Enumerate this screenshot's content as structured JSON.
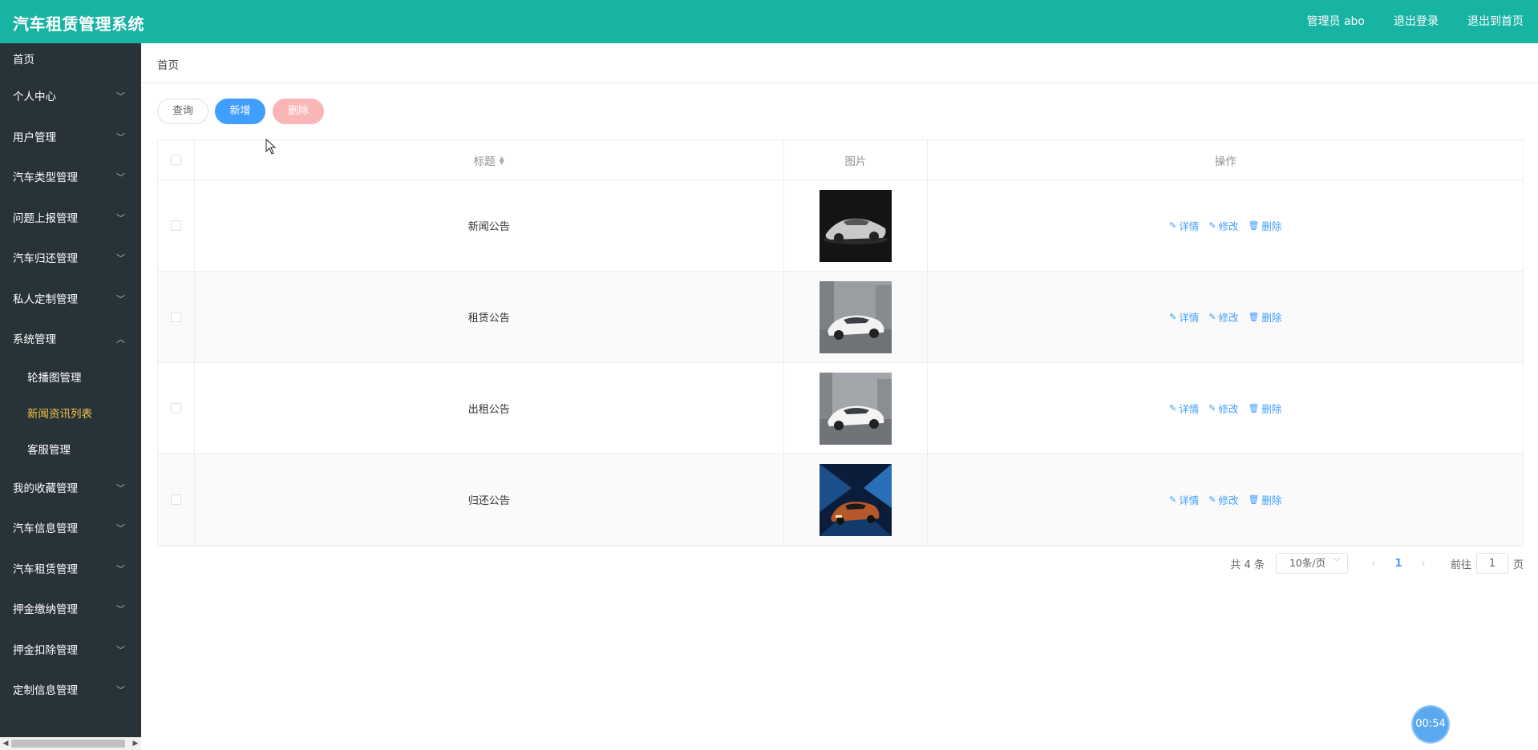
{
  "header": {
    "title": "汽车租赁管理系统",
    "user_label": "管理员 abo",
    "logout": "退出登录",
    "exit_home": "退出到首页",
    "bg_color": "#17b3a3"
  },
  "sidebar": {
    "items": [
      {
        "label": "首页",
        "expandable": false
      },
      {
        "label": "个人中心",
        "expandable": true
      },
      {
        "label": "用户管理",
        "expandable": true
      },
      {
        "label": "汽车类型管理",
        "expandable": true
      },
      {
        "label": "问题上报管理",
        "expandable": true
      },
      {
        "label": "汽车归还管理",
        "expandable": true
      },
      {
        "label": "私人定制管理",
        "expandable": true
      },
      {
        "label": "系统管理",
        "expandable": true,
        "expanded": true,
        "children": [
          {
            "label": "轮播图管理"
          },
          {
            "label": "新闻资讯列表",
            "active": true
          },
          {
            "label": "客服管理"
          }
        ]
      },
      {
        "label": "我的收藏管理",
        "expandable": true
      },
      {
        "label": "汽车信息管理",
        "expandable": true
      },
      {
        "label": "汽车租赁管理",
        "expandable": true
      },
      {
        "label": "押金缴纳管理",
        "expandable": true
      },
      {
        "label": "押金扣除管理",
        "expandable": true
      },
      {
        "label": "定制信息管理",
        "expandable": true
      }
    ]
  },
  "breadcrumb": "首页",
  "toolbar": {
    "query": "查询",
    "add": "新增",
    "delete": "删除"
  },
  "table": {
    "headers": {
      "title": "标题",
      "image": "图片",
      "actions": "操作"
    },
    "rows": [
      {
        "title": "新闻公告",
        "image_icon": "car-silver-concept-image"
      },
      {
        "title": "租赁公告",
        "image_icon": "car-white-sedan-image"
      },
      {
        "title": "出租公告",
        "image_icon": "car-white-sedan-image"
      },
      {
        "title": "归还公告",
        "image_icon": "car-orange-night-image"
      }
    ],
    "actions": {
      "detail": "详情",
      "edit": "修改",
      "delete": "删除"
    }
  },
  "pagination": {
    "total": "共 4 条",
    "page_size": "10条/页",
    "current_page": "1",
    "goto_prefix": "前往",
    "goto_value": "1",
    "goto_suffix": "页"
  },
  "timer": "00:54"
}
